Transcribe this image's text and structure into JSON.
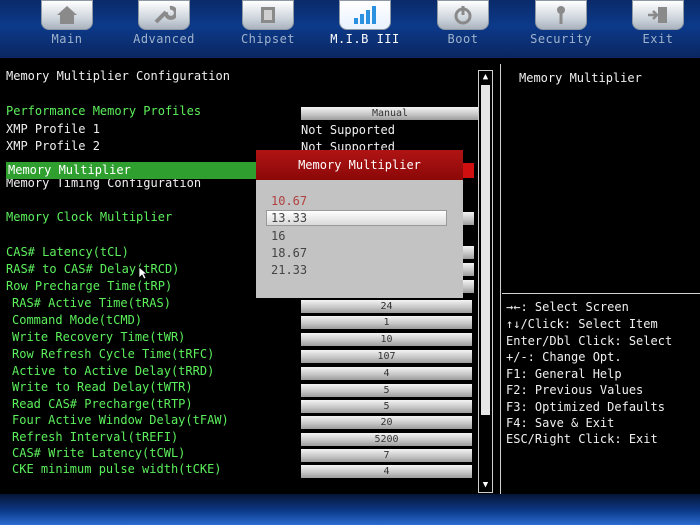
{
  "tabs": [
    {
      "label": "Main",
      "icon": "home-icon"
    },
    {
      "label": "Advanced",
      "icon": "wrench-icon"
    },
    {
      "label": "Chipset",
      "icon": "chip-icon"
    },
    {
      "label": "M.I.B III",
      "icon": "chart-icon",
      "active": true
    },
    {
      "label": "Boot",
      "icon": "power-icon"
    },
    {
      "label": "Security",
      "icon": "key-icon"
    },
    {
      "label": "Exit",
      "icon": "exit-icon"
    }
  ],
  "main": {
    "title": "Memory Multiplier Configuration",
    "perf_profiles_label": "Performance Memory Profiles",
    "perf_profiles_value": "Manual",
    "xmp1_label": "XMP Profile 1",
    "xmp1_value": "Not Supported",
    "xmp2_label": "XMP Profile 2",
    "xmp2_value": "Not Supported",
    "timing_title": "Memory Timing Configuration",
    "items": [
      {
        "label": "Memory Clock Multiplier",
        "value": ""
      },
      {
        "label": "Memory Multiplier",
        "value": ""
      },
      {
        "label": "CAS# Latency(tCL)",
        "value": ""
      },
      {
        "label": "RAS# to CAS# Delay(tRCD)",
        "value": ""
      },
      {
        "label": "Row Precharge Time(tRP)",
        "value": ""
      },
      {
        "label": "RAS# Active Time(tRAS)",
        "value": "24"
      },
      {
        "label": "Command Mode(tCMD)",
        "value": "1"
      },
      {
        "label": "Write Recovery Time(tWR)",
        "value": "10"
      },
      {
        "label": "Row Refresh Cycle Time(tRFC)",
        "value": "107"
      },
      {
        "label": "Active to Active Delay(tRRD)",
        "value": "4"
      },
      {
        "label": "Write to Read Delay(tWTR)",
        "value": "5"
      },
      {
        "label": "Read CAS# Precharge(tRTP)",
        "value": "5"
      },
      {
        "label": "Four Active Window Delay(tFAW)",
        "value": "20"
      },
      {
        "label": "Refresh Interval(tREFI)",
        "value": "5200"
      },
      {
        "label": "CAS# Write Latency(tCWL)",
        "value": "7"
      },
      {
        "label": "CKE minimum pulse width(tCKE)",
        "value": "4"
      }
    ]
  },
  "popup": {
    "title": "Memory Multiplier",
    "options": [
      "10.67",
      "13.33",
      "16",
      "18.67",
      "21.33"
    ],
    "selected_index": 1
  },
  "help": {
    "title": "Memory Multiplier",
    "lines": [
      "→←: Select Screen",
      "↑↓/Click: Select Item",
      "Enter/Dbl Click: Select",
      "+/-: Change Opt.",
      "F1: General Help",
      "F2: Previous Values",
      "F3: Optimized Defaults",
      "F4: Save & Exit",
      "ESC/Right Click: Exit"
    ]
  },
  "colors": {
    "accent_green": "#5cf05c",
    "highlight_green": "#2fa02f",
    "popup_red": "#b01414"
  }
}
